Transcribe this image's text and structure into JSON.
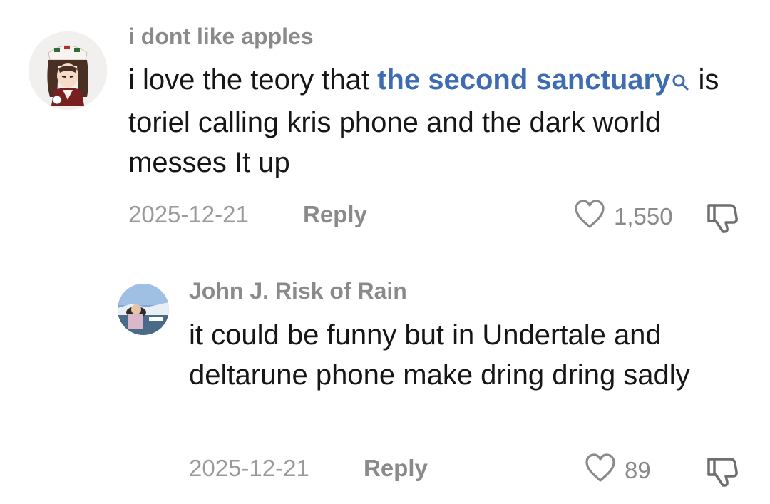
{
  "comments": [
    {
      "username": "i dont like apples",
      "text_before": "i love the teory that ",
      "link_text": "the second sanctuary",
      "text_after": " is toriel calling kris phone and the dark world messes It up",
      "date": "2025-12-21",
      "reply_label": "Reply",
      "likes": "1,550",
      "avatar_icon": "anime-character-avatar",
      "link_icon": "search-icon",
      "like_icon": "heart-outline-icon",
      "dislike_icon": "thumbs-down-icon"
    },
    {
      "username": "John J. Risk of Rain",
      "text": "it could be funny but in Undertale and deltarune phone make dring dring sadly",
      "date": "2025-12-21",
      "reply_label": "Reply",
      "likes": "89",
      "avatar_icon": "landscape-photo-avatar",
      "like_icon": "heart-outline-icon",
      "dislike_icon": "thumbs-down-icon"
    }
  ],
  "colors": {
    "link": "#3e6cb0",
    "username": "#8a8a8a",
    "meta": "#9a9a9a",
    "text": "#161616"
  }
}
